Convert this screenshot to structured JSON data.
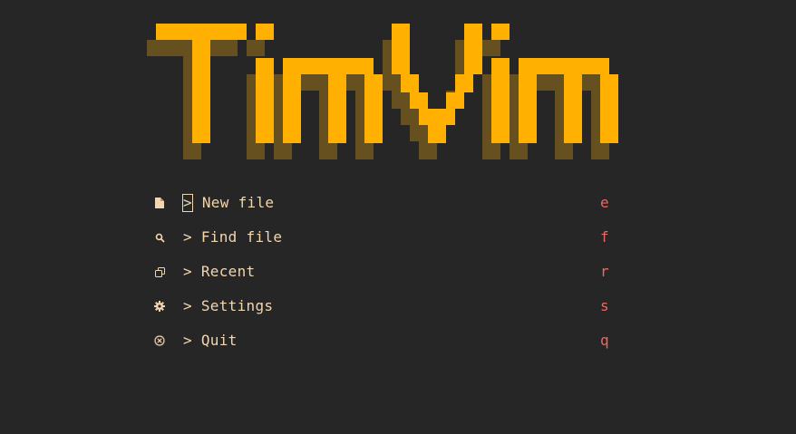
{
  "logo": {
    "text": "TimVim",
    "front_color": "#ffb000",
    "shadow_color": "#66501f"
  },
  "menu": {
    "items": [
      {
        "icon": "file-icon",
        "arrow": ">",
        "label": "New file",
        "key": "e"
      },
      {
        "icon": "search-icon",
        "arrow": ">",
        "label": "Find file",
        "key": "f"
      },
      {
        "icon": "copy-icon",
        "arrow": ">",
        "label": "Recent",
        "key": "r"
      },
      {
        "icon": "gear-icon",
        "arrow": ">",
        "label": "Settings",
        "key": "s"
      },
      {
        "icon": "close-circle-icon",
        "arrow": ">",
        "label": "Quit",
        "key": "q"
      }
    ]
  },
  "colors": {
    "background": "#262626",
    "label": "#f1d6b0",
    "key": "#ea6962",
    "icon": "#f1d6b0"
  }
}
